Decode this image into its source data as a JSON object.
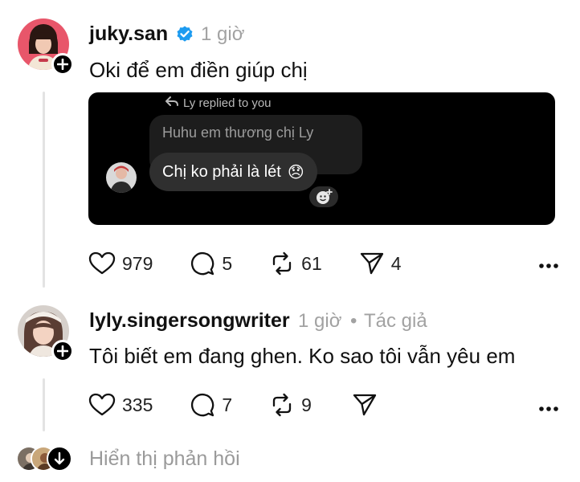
{
  "comments": [
    {
      "username": "juky.san",
      "verified": true,
      "time": "1 giờ",
      "text": "Oki để em điền giúp chị",
      "attachment": {
        "replied_label": "Ly replied to you",
        "quoted_message": "Huhu em thương chị Ly",
        "message": "Chị ko phải là lét",
        "emoji": "😞"
      },
      "likes": "979",
      "replies": "5",
      "reposts": "61",
      "shares": "4"
    },
    {
      "username": "lyly.singersongwriter",
      "time": "1 giờ",
      "author_tag": "Tác giả",
      "separator": "•",
      "text": "Tôi biết em đang ghen. Ko sao tôi vẫn yêu em",
      "likes": "335",
      "replies": "7",
      "reposts": "9"
    }
  ],
  "show_replies_label": "Hiển thị phản hồi",
  "colors": {
    "verified": "#1d9bf0",
    "meta_gray": "#a2a2a2",
    "thread_line": "#e3e3e3"
  }
}
